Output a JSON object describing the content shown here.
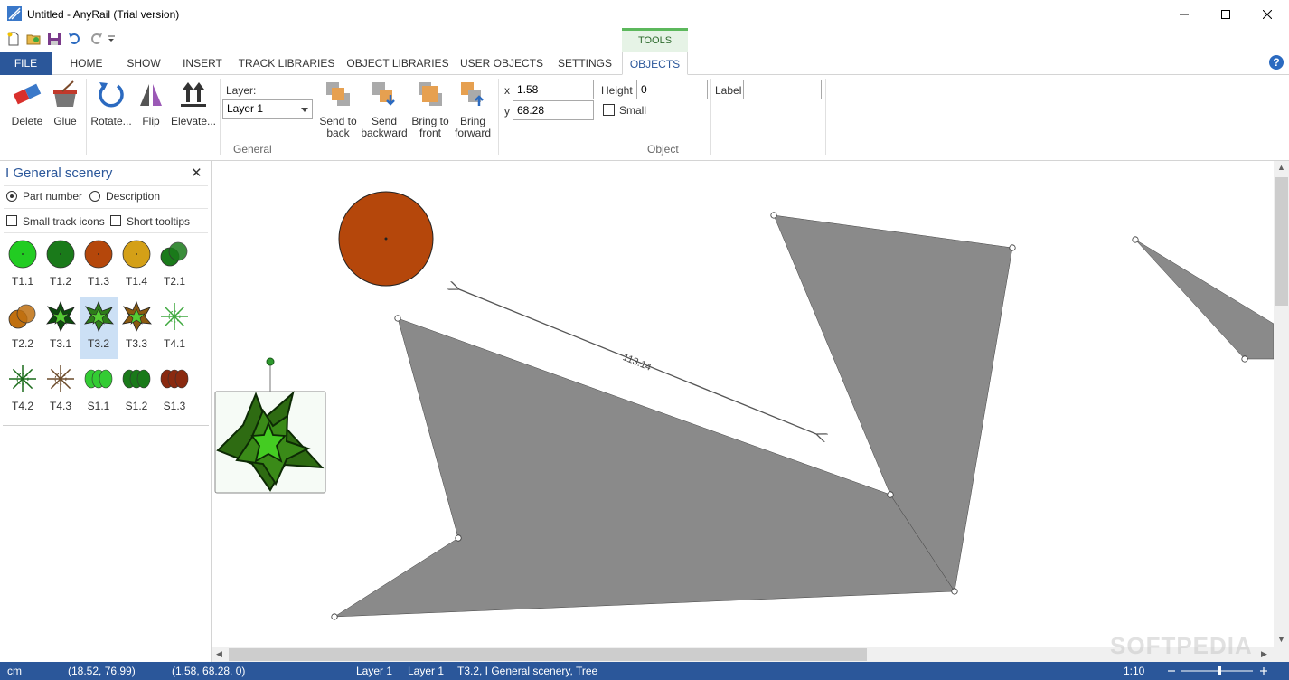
{
  "window": {
    "title": "Untitled - AnyRail (Trial version)",
    "minimize": "—",
    "maximize": "☐",
    "close": "✕"
  },
  "ribbon": {
    "contextual_group": "TOOLS",
    "tabs": [
      "FILE",
      "HOME",
      "SHOW",
      "INSERT",
      "TRACK LIBRARIES",
      "OBJECT LIBRARIES",
      "USER OBJECTS",
      "SETTINGS",
      "OBJECTS"
    ],
    "active_tab": "OBJECTS",
    "help": "?",
    "buttons": {
      "delete": "Delete",
      "glue": "Glue",
      "rotate": "Rotate...",
      "flip": "Flip",
      "elevate": "Elevate...",
      "send_to_back": [
        "Send to",
        "back"
      ],
      "send_backward": [
        "Send",
        "backward"
      ],
      "bring_to_front": [
        "Bring to",
        "front"
      ],
      "bring_forward": [
        "Bring",
        "forward"
      ]
    },
    "layer_label": "Layer:",
    "layer_value": "Layer 1",
    "group_general": "General",
    "x_label": "x",
    "x_value": "1.58",
    "y_label": "y",
    "y_value": "68.28",
    "height_label": "Height",
    "height_value": "0",
    "small_label": "Small",
    "small_checked": false,
    "label_label": "Label",
    "label_value": "",
    "group_object": "Object"
  },
  "panel": {
    "title": "I General scenery",
    "close": "✕",
    "radio_part_number": "Part number",
    "radio_description": "Description",
    "radio_selected": "part_number",
    "cb_small_icons": "Small track icons",
    "cb_short_tooltips": "Short tooltips",
    "items": [
      {
        "label": "T1.1",
        "color": "#22cc22"
      },
      {
        "label": "T1.2",
        "color": "#1a7a1a"
      },
      {
        "label": "T1.3",
        "color": "#b5470b"
      },
      {
        "label": "T1.4",
        "color": "#d4a017"
      },
      {
        "label": "T2.1",
        "color": "#1a7a1a"
      },
      {
        "label": "T2.2",
        "color": "#c07010"
      },
      {
        "label": "T3.1",
        "color": "#0d4d0d"
      },
      {
        "label": "T3.2",
        "color": "#2e7d1a",
        "selected": true
      },
      {
        "label": "T3.3",
        "color": "#8a5a10"
      },
      {
        "label": "T4.1",
        "color": "#3fa83f"
      },
      {
        "label": "T4.2",
        "color": "#1a6b1a"
      },
      {
        "label": "T4.3",
        "color": "#6b4a2a"
      },
      {
        "label": "S1.1",
        "color": "#33cc33"
      },
      {
        "label": "S1.2",
        "color": "#1a7a1a"
      },
      {
        "label": "S1.3",
        "color": "#8a2a10"
      }
    ]
  },
  "canvas": {
    "measure_label": "113.14"
  },
  "status": {
    "unit": "cm",
    "cursor": "(18.52, 76.99)",
    "object_pos": "(1.58, 68.28, 0)",
    "layer_a": "Layer 1",
    "layer_b": "Layer 1",
    "selection": "T3.2, I General scenery, Tree",
    "scale": "1:10"
  },
  "watermark": "SOFTPEDIA",
  "colors": {
    "accent": "#2b579a",
    "shape_fill": "#8a8a8a",
    "circle_fill": "#b5470b",
    "tree_dark": "#2e6b12",
    "tree_light": "#44cc22"
  }
}
